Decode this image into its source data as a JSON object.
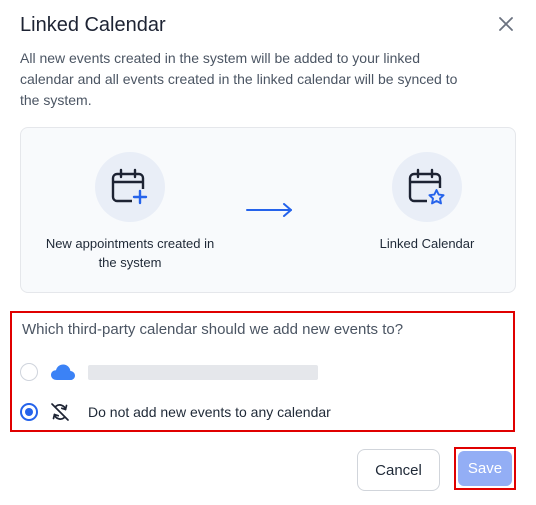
{
  "dialog": {
    "title": "Linked Calendar",
    "description": "All new events created in the system will be added to your linked calendar and all events created in the linked calendar will be synced to the system."
  },
  "flow": {
    "source_label": "New appointments created in the system",
    "source_icon": "calendar-plus-icon",
    "arrow_icon": "arrow-right-icon",
    "target_label": "Linked Calendar",
    "target_icon": "calendar-star-icon"
  },
  "calendar_choice": {
    "question": "Which third-party calendar should we add new events to?",
    "options": [
      {
        "icon": "cloud-icon",
        "label": "",
        "selected": false
      },
      {
        "icon": "sync-off-icon",
        "label": "Do not add new events to any calendar",
        "selected": true
      }
    ]
  },
  "footer": {
    "cancel_label": "Cancel",
    "save_label": "Save"
  },
  "colors": {
    "accent": "#2563eb",
    "save_disabled": "#93aef5",
    "highlight": "#e00000"
  }
}
